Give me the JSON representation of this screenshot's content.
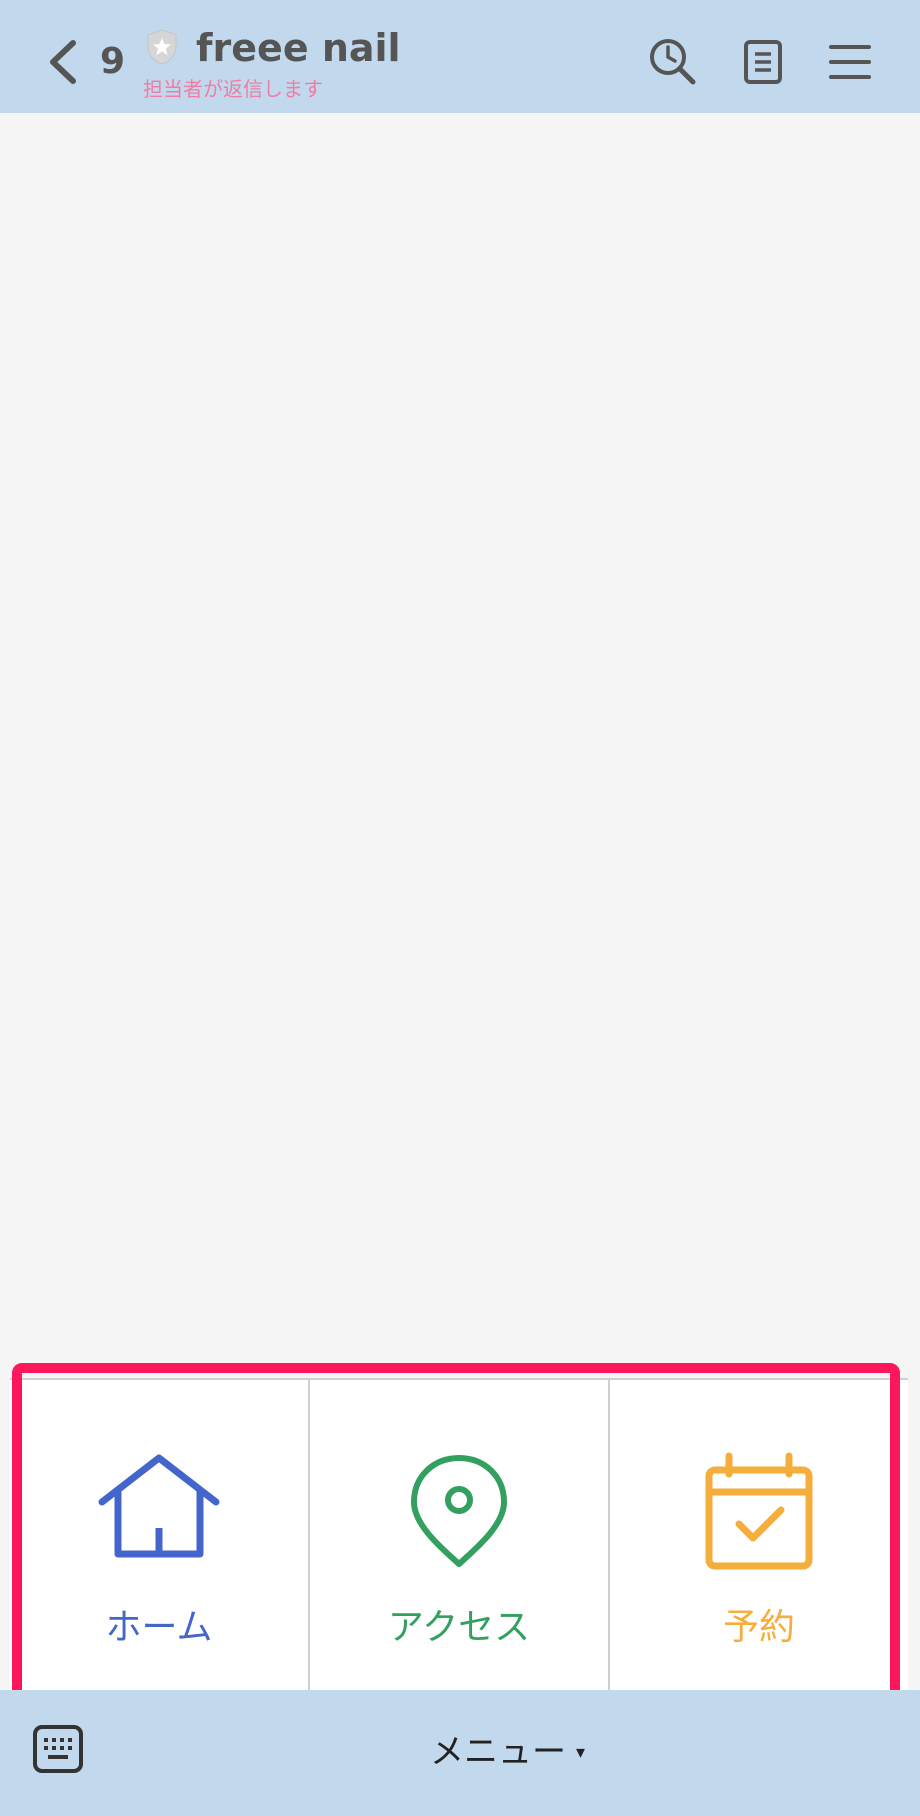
{
  "header": {
    "unread_count": "9",
    "title": "freee nail",
    "subtitle": "担当者が返信します",
    "icons": [
      "back-icon",
      "shield-star-icon",
      "search-history-icon",
      "notes-icon",
      "menu-icon"
    ]
  },
  "rich_menu": {
    "items": [
      {
        "label": "ホーム",
        "icon": "home-icon",
        "color": "#4466cc"
      },
      {
        "label": "アクセス",
        "icon": "map-pin-icon",
        "color": "#33a060"
      },
      {
        "label": "予約",
        "icon": "calendar-check-icon",
        "color": "#f5ad3c"
      }
    ],
    "highlight_color": "#fc175b"
  },
  "bottom_bar": {
    "menu_label": "メニュー",
    "arrow": "▾",
    "icons": [
      "keyboard-icon"
    ]
  },
  "colors": {
    "header_bg": "#c2d9ed",
    "chat_bg": "#f5f5f5",
    "subtitle": "#f07ca3"
  }
}
